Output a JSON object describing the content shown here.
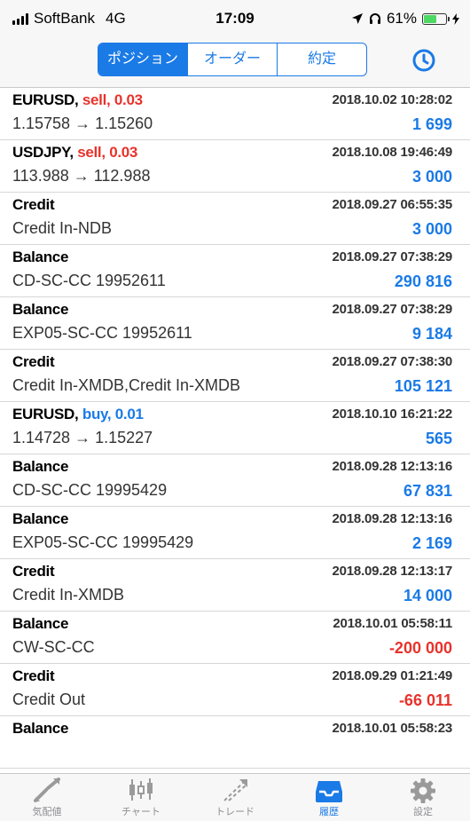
{
  "status": {
    "carrier": "SoftBank",
    "network": "4G",
    "time": "17:09",
    "battery": "61%",
    "battery_level": 0.61
  },
  "segments": [
    {
      "label": "ポジション",
      "active": false
    },
    {
      "label": "オーダー",
      "active": false
    },
    {
      "label": "約定",
      "active": false
    }
  ],
  "segment_active_label": "ポジション",
  "history": [
    {
      "title": "EURUSD,",
      "action": "sell, 0.03",
      "time": "2018.10.02 10:28:02",
      "sub": "1.15758 → 1.15260",
      "amount": "1 699"
    },
    {
      "title": "USDJPY,",
      "action": "sell, 0.03",
      "time": "2018.10.08 19:46:49",
      "sub": "113.988 → 112.988",
      "amount": "3 000"
    },
    {
      "title": "Credit",
      "action": "",
      "time": "2018.09.27 06:55:35",
      "sub": "Credit In-NDB",
      "amount": "3 000"
    },
    {
      "title": "Balance",
      "action": "",
      "time": "2018.09.27 07:38:29",
      "sub": "CD-SC-CC 19952611",
      "amount": "290 816"
    },
    {
      "title": "Balance",
      "action": "",
      "time": "2018.09.27 07:38:29",
      "sub": "EXP05-SC-CC 19952611",
      "amount": "9 184"
    },
    {
      "title": "Credit",
      "action": "",
      "time": "2018.09.27 07:38:30",
      "sub": "Credit In-XMDB,Credit In-XMDB",
      "amount": "105 121"
    },
    {
      "title": "EURUSD,",
      "action": "buy, 0.01",
      "time": "2018.10.10 16:21:22",
      "sub": "1.14728 → 1.15227",
      "amount": "565"
    },
    {
      "title": "Balance",
      "action": "",
      "time": "2018.09.28 12:13:16",
      "sub": "CD-SC-CC 19995429",
      "amount": "67 831"
    },
    {
      "title": "Balance",
      "action": "",
      "time": "2018.09.28 12:13:16",
      "sub": "EXP05-SC-CC 19995429",
      "amount": "2 169"
    },
    {
      "title": "Credit",
      "action": "",
      "time": "2018.09.28 12:13:17",
      "sub": "Credit In-XMDB",
      "amount": "14 000"
    },
    {
      "title": "Balance",
      "action": "",
      "time": "2018.10.01 05:58:11",
      "sub": "CW-SC-CC",
      "amount": "-200 000"
    },
    {
      "title": "Credit",
      "action": "",
      "time": "2018.09.29 01:21:49",
      "sub": "Credit Out",
      "amount": "-66 011"
    },
    {
      "title": "Balance",
      "action": "",
      "time": "2018.10.01 05:58:23",
      "sub": "",
      "amount": ""
    }
  ],
  "tabbar": [
    {
      "label": "気配値",
      "icon": "quotes-icon",
      "active": false
    },
    {
      "label": "チャート",
      "icon": "candlestick-chart-icon",
      "active": false
    },
    {
      "label": "トレード",
      "icon": "trade-icon",
      "active": false
    },
    {
      "label": "履歴",
      "icon": "history-inbox-icon",
      "active": true
    },
    {
      "label": "設定",
      "icon": "gear-icon",
      "active": false
    }
  ],
  "colors": {
    "accent": "#1a7ae6",
    "sell": "#e8322b",
    "buy": "#1a7ae6",
    "negative": "#e8322b",
    "battery": "#4cd964"
  }
}
